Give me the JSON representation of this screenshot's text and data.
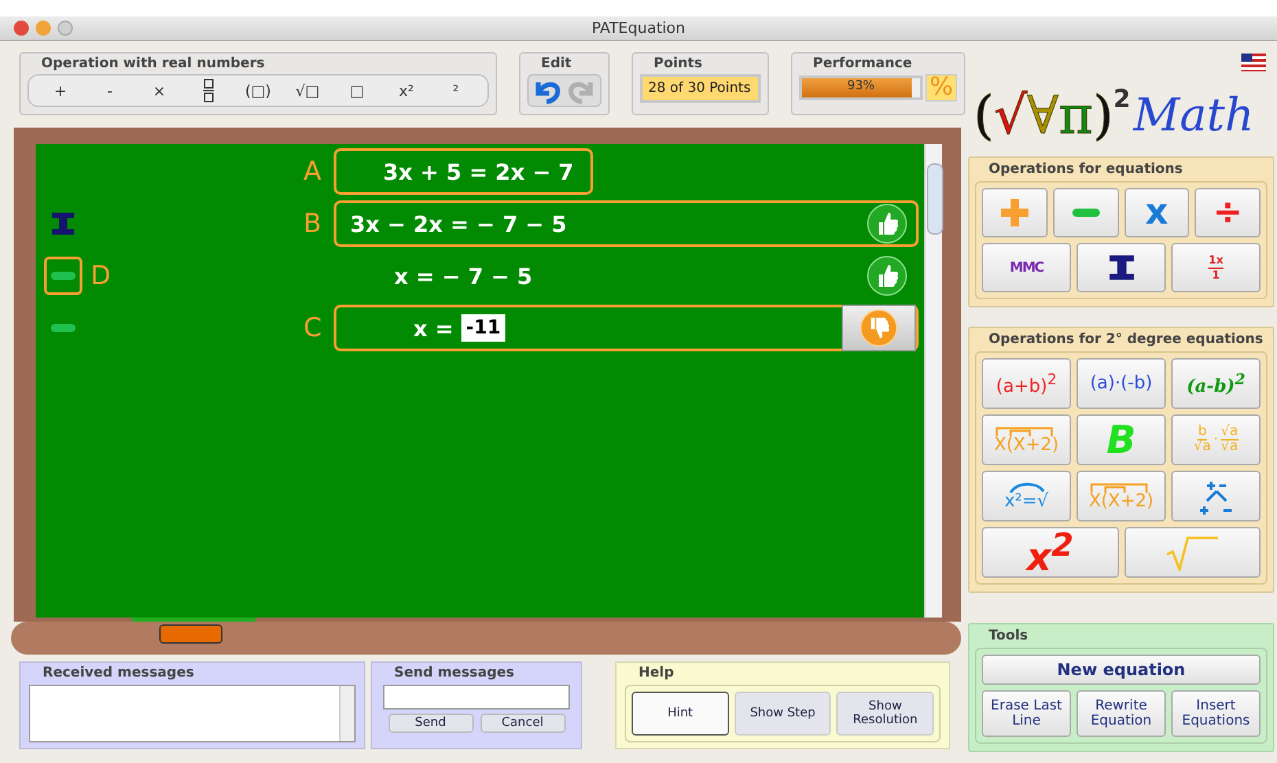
{
  "window": {
    "title": "PATEquation"
  },
  "operations": {
    "title": "Operation with real numbers",
    "buttons": [
      {
        "kind": "text",
        "label": "+"
      },
      {
        "kind": "text",
        "label": "-"
      },
      {
        "kind": "text",
        "label": "×"
      },
      {
        "kind": "fraction"
      },
      {
        "kind": "text",
        "label": "(□)"
      },
      {
        "kind": "text",
        "label": "√□"
      },
      {
        "kind": "text",
        "label": "□"
      },
      {
        "kind": "text",
        "label": "x²"
      },
      {
        "kind": "text",
        "label": "²"
      }
    ]
  },
  "edit": {
    "title": "Edit",
    "buttons": [
      {
        "kind": "undo",
        "disabled": false
      },
      {
        "kind": "redo",
        "disabled": true
      }
    ]
  },
  "points": {
    "title": "Points",
    "value": "28 of 30 Points"
  },
  "performance": {
    "title": "Performance",
    "level": 0.93,
    "reading": "93%",
    "button": "%"
  },
  "board": {
    "steps": [
      {
        "label": "A",
        "equation": "3x + 5 = 2x − 7",
        "highlighted": true
      },
      {
        "label": "B",
        "equation": "3x − 2x = − 7 − 5",
        "highlighted": true,
        "correct": true,
        "side": {
          "kind": "ibeam",
          "highlighted": false
        }
      },
      {
        "equation": "x = − 7 − 5",
        "highlighted": false,
        "correct": true,
        "side": {
          "kind": "minus",
          "highlighted": true,
          "label": "D"
        }
      },
      {
        "label": "C",
        "equation": "x =",
        "answer": "-11",
        "highlighted": true,
        "correct": false,
        "side": {
          "kind": "minus",
          "highlighted": false
        }
      }
    ]
  },
  "logo": {
    "parts": [
      {
        "text": "(",
        "color": "#111111"
      },
      {
        "text": "√",
        "color": "#e01010"
      },
      {
        "text": "∀",
        "color": "#a89000"
      },
      {
        "text": "π",
        "color": "#108a10"
      },
      {
        "text": ")",
        "color": "#111111"
      }
    ],
    "exponent": "2",
    "word": "Math"
  },
  "equation_operations": {
    "title": "Operations for equations",
    "rows": [
      [
        {
          "kind": "plus",
          "color": "#f7a030"
        },
        {
          "kind": "minus",
          "color": "#20c040"
        },
        {
          "kind": "text",
          "label": "x",
          "color": "#1a7ad8"
        },
        {
          "kind": "text",
          "label": "÷",
          "color": "#f02020"
        }
      ],
      [
        {
          "kind": "text",
          "label": "MMC",
          "color": "#7a2ab0"
        },
        {
          "kind": "ibeam",
          "color": "#1a1a80"
        },
        {
          "kind": "frac",
          "numerator": "1x",
          "denominator": "1",
          "color": "#e02020"
        }
      ]
    ]
  },
  "second_degree": {
    "title": "Operations for 2° degree equations",
    "rows": [
      [
        {
          "kind": "text",
          "label": "(a+b)$^{2}$",
          "color": "#f02020"
        },
        {
          "kind": "text",
          "label": "(a)·(-b)",
          "color": "#2a4ad8"
        },
        {
          "kind": "italic",
          "label": "(a-b)$^{2}$",
          "color": "#109a10"
        }
      ],
      [
        {
          "kind": "distribute",
          "label": "X(X+2)",
          "color": "#f5a020"
        },
        {
          "kind": "big",
          "label": "B",
          "color": "#20e020"
        },
        {
          "kind": "rationalize",
          "parts": [
            "b",
            "√a",
            "·",
            "√a",
            "√a"
          ],
          "color": "#f5b020"
        }
      ],
      [
        {
          "kind": "root",
          "label": "x²=√",
          "color": "#1a8ae0"
        },
        {
          "kind": "distribute",
          "label": "X(X+2)",
          "color": "#f5a020"
        },
        {
          "kind": "signs",
          "color": "#1a7ad8"
        }
      ],
      [
        {
          "kind": "big",
          "label": "x$^{2}$",
          "color": "#f02010"
        },
        {
          "kind": "sqrt",
          "color": "#f5c020"
        }
      ]
    ]
  },
  "messages": {
    "received_title": "Received messages",
    "send_title": "Send messages",
    "send": "Send",
    "cancel": "Cancel"
  },
  "help": {
    "title": "Help",
    "buttons": [
      {
        "label": "Hint",
        "selected": true
      },
      {
        "label": "Show Step",
        "selected": false
      },
      {
        "label": "Show Resolution",
        "selected": false
      }
    ]
  },
  "tools": {
    "title": "Tools",
    "main": "New equation",
    "buttons": [
      "Erase Last Line",
      "Rewrite Equation",
      "Insert Equations"
    ]
  }
}
